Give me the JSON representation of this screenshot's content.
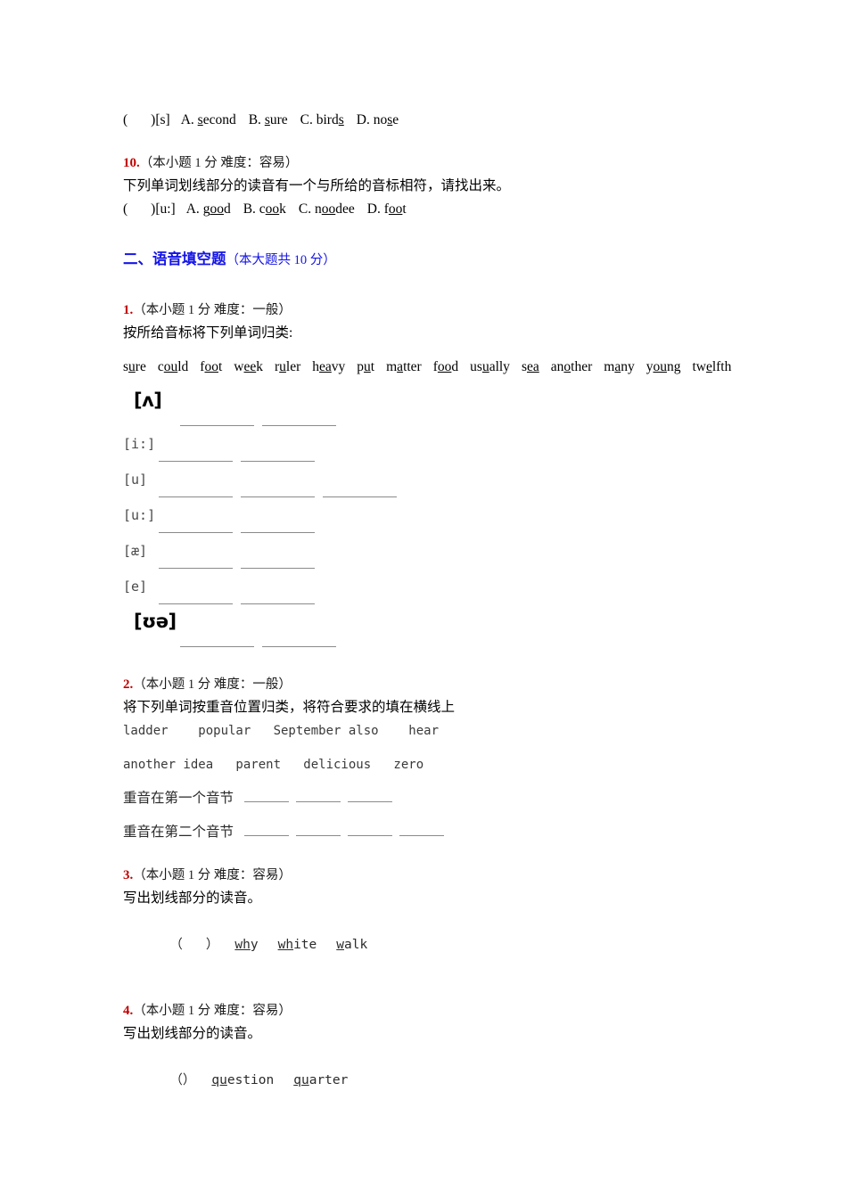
{
  "colors": {
    "question_number": "#c00000",
    "section_heading": "#1414e6",
    "blank_rule": "#8a8a8a",
    "muted_text": "#4a4a4a"
  },
  "top_choice_row": {
    "open_paren": "(",
    "close_paren": ")",
    "phonetic": "[s]",
    "options": [
      {
        "label": "A.",
        "pre": "",
        "under": "s",
        "post": "econd"
      },
      {
        "label": "B.",
        "pre": "",
        "under": "s",
        "post": "ure"
      },
      {
        "label": "C.",
        "pre": "bird",
        "under": "s",
        "post": ""
      },
      {
        "label": "D.",
        "pre": "no",
        "under": "s",
        "post": "e"
      }
    ]
  },
  "question10": {
    "number": "10.",
    "meta": "（本小题 1 分 难度：容易）",
    "stem": "下列单词划线部分的读音有一个与所给的音标相符，请找出来。",
    "open_paren": "(",
    "close_paren": ")",
    "phonetic": "[u:]",
    "options": [
      {
        "label": "A.",
        "pre": "g",
        "under": "oo",
        "post": "d"
      },
      {
        "label": "B.",
        "pre": "c",
        "under": "oo",
        "post": "k"
      },
      {
        "label": "C.",
        "pre": "n",
        "under": "oo",
        "post": "dee"
      },
      {
        "label": "D.",
        "pre": "f",
        "under": "oo",
        "post": "t"
      }
    ]
  },
  "section2": {
    "title": "二、语音填空题",
    "subtitle": "（本大题共 10 分）"
  },
  "question1": {
    "number": "1.",
    "meta": "（本小题 1 分 难度：一般）",
    "stem": "按所给音标将下列单词归类:",
    "word_bank": [
      {
        "pre": "s",
        "under": "u",
        "post": "re"
      },
      {
        "pre": "c",
        "under": "ou",
        "post": "ld"
      },
      {
        "pre": "f",
        "under": "oo",
        "post": "t"
      },
      {
        "pre": "w",
        "under": "ee",
        "post": "k"
      },
      {
        "pre": "r",
        "under": "u",
        "post": "ler"
      },
      {
        "pre": "h",
        "under": "ea",
        "post": "vy"
      },
      {
        "pre": "p",
        "under": "u",
        "post": "t"
      },
      {
        "pre": "m",
        "under": "a",
        "post": "tter"
      },
      {
        "pre": "f",
        "under": "oo",
        "post": "d"
      },
      {
        "pre": "us",
        "under": "u",
        "post": "ally"
      },
      {
        "pre": "s",
        "under": "ea",
        "post": ""
      },
      {
        "pre": "an",
        "under": "o",
        "post": "ther"
      },
      {
        "pre": "m",
        "under": "a",
        "post": "ny"
      },
      {
        "pre": "y",
        "under": "ou",
        "post": "ng"
      },
      {
        "pre": "tw",
        "under": "e",
        "post": "lfth"
      }
    ],
    "phonetic_rows": [
      {
        "symbol": "[ʌ]",
        "style": "big",
        "blanks": 2,
        "indent": 12,
        "offset_blanks": true
      },
      {
        "symbol": "[i:]",
        "style": "mono",
        "blanks": 2,
        "indent": 0,
        "offset_blanks": false
      },
      {
        "symbol": "[u]",
        "style": "mono",
        "blanks": 3,
        "indent": 0,
        "offset_blanks": false
      },
      {
        "symbol": "[u:]",
        "style": "mono",
        "blanks": 2,
        "indent": 0,
        "offset_blanks": false
      },
      {
        "symbol": "[æ]",
        "style": "mono",
        "blanks": 2,
        "indent": 0,
        "offset_blanks": false
      },
      {
        "symbol": "[e]",
        "style": "mono",
        "blanks": 2,
        "indent": 0,
        "offset_blanks": false
      },
      {
        "symbol": "[ʊə]",
        "style": "big",
        "blanks": 2,
        "indent": 12,
        "offset_blanks": true
      }
    ]
  },
  "question2": {
    "number": "2.",
    "meta": "（本小题 1 分 难度：一般）",
    "stem": "将下列单词按重音位置归类，将符合要求的填在横线上",
    "words_line1": "ladder    popular   September also    hear",
    "words_line2": "another idea   parent   delicious   zero",
    "stress_first_label": "重音在第一个音节",
    "stress_first_blanks": 3,
    "stress_second_label": "重音在第二个音节",
    "stress_second_blanks": 4
  },
  "question3": {
    "number": "3.",
    "meta": "（本小题 1 分 难度：容易）",
    "stem": "写出划线部分的读音。",
    "open_paren": "（",
    "close_paren": "）",
    "words": [
      {
        "under": "wh",
        "post": "y"
      },
      {
        "under": "wh",
        "post": "ite"
      },
      {
        "under": "w",
        "post": "alk"
      }
    ]
  },
  "question4": {
    "number": "4.",
    "meta": "（本小题 1 分 难度：容易）",
    "stem": "写出划线部分的读音。",
    "open_paren": "（",
    "close_paren": "）",
    "words": [
      {
        "under": "qu",
        "post": "estion"
      },
      {
        "under": "qu",
        "post": "arter"
      }
    ]
  }
}
